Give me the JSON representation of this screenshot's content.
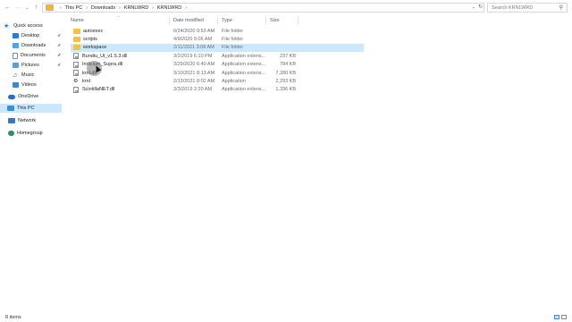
{
  "address": {
    "crumbs": [
      "This PC",
      "Downloads",
      "KRNLWRD",
      "KRNLWRD"
    ],
    "search_placeholder": "Search KRNLWRD"
  },
  "nav": {
    "quick_access": "Quick access",
    "items": [
      {
        "label": "Desktop",
        "icon": "desktop-icon",
        "pinned": true
      },
      {
        "label": "Downloads",
        "icon": "downloads-icon",
        "pinned": true
      },
      {
        "label": "Documents",
        "icon": "documents-icon",
        "pinned": true
      },
      {
        "label": "Pictures",
        "icon": "pictures-icon",
        "pinned": true
      },
      {
        "label": "Music",
        "icon": "music-icon",
        "pinned": false
      },
      {
        "label": "Videos",
        "icon": "videos-icon",
        "pinned": false
      }
    ],
    "onedrive": "OneDrive",
    "this_pc": "This PC",
    "network": "Network",
    "homegroup": "Homegroup"
  },
  "columns": {
    "name": "Name",
    "date": "Date modified",
    "type": "Type",
    "size": "Size"
  },
  "files": [
    {
      "name": "autoexec",
      "date": "6/24/2020 9:53 AM",
      "type": "File folder",
      "size": "",
      "kind": "folder"
    },
    {
      "name": "scripts",
      "date": "4/9/2020 9:06 AM",
      "type": "File folder",
      "size": "",
      "kind": "folder"
    },
    {
      "name": "workspace",
      "date": "2/11/2021 3:08 AM",
      "type": "File folder",
      "size": "",
      "kind": "folder"
    },
    {
      "name": "Bundiu_Ul_v1.5.3.dll",
      "date": "3/2/2019 6:10 PM",
      "type": "Application extens...",
      "size": "237 KB",
      "kind": "dll"
    },
    {
      "name": "Indicium_Supra.dll",
      "date": "3/29/2020 6:40 AM",
      "type": "Application extens...",
      "size": "784 KB",
      "kind": "dll"
    },
    {
      "name": "krnl.dll",
      "date": "3/10/2021 8:13 AM",
      "type": "Application extens...",
      "size": "7,280 KB",
      "kind": "dll"
    },
    {
      "name": "krnl",
      "date": "2/13/2021 8:02 AM",
      "type": "Application",
      "size": "2,293 KB",
      "kind": "exe"
    },
    {
      "name": "ScintillaNET.dll",
      "date": "3/3/2019 2:20 AM",
      "type": "Application extens...",
      "size": "1,336 KB",
      "kind": "dll"
    }
  ],
  "status": {
    "count": "8 items"
  },
  "colors": {
    "selection": "#cce8ff",
    "folder": "#f0c24a",
    "accent": "#2b7dd6"
  }
}
